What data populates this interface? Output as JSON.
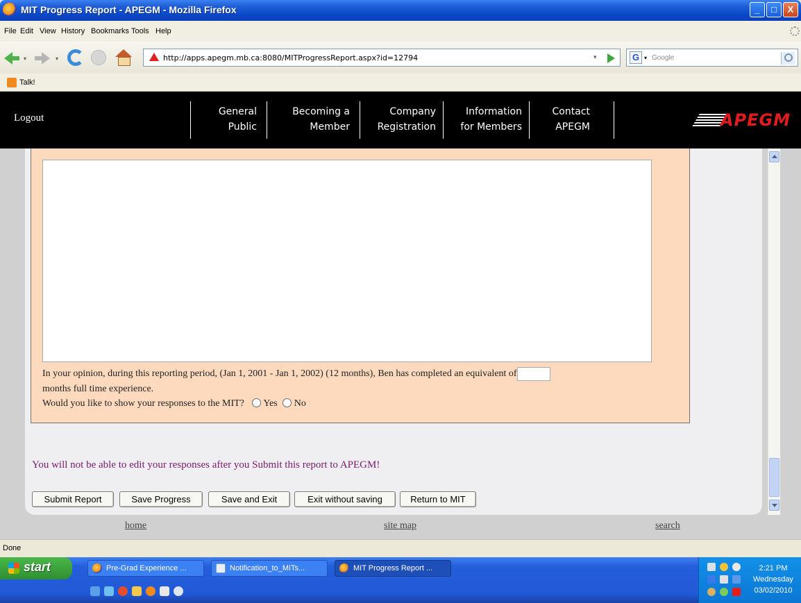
{
  "window": {
    "title": "MIT Progress Report - APEGM - Mozilla Firefox",
    "min_glyph": "_",
    "max_glyph": "□",
    "close_glyph": "X"
  },
  "menu": [
    "File",
    "Edit",
    "View",
    "History",
    "Bookmarks",
    "Tools",
    "Help"
  ],
  "toolbar": {
    "url": "http://apps.apegm.mb.ca:8080/MITProgressReport.aspx?id=12794",
    "search_placeholder": "Google",
    "search_engine_glyph": "G",
    "dropdown_glyph": "▾"
  },
  "bookmarks": {
    "item": "Talk!"
  },
  "site_nav": {
    "logout": "Logout",
    "items": [
      "General\nPublic",
      "Becoming a\nMember",
      "Company\nRegistration",
      "Information\nfor Members",
      "Contact\nAPEGM"
    ],
    "logo": "APEGM"
  },
  "form": {
    "question_text": "In your opinion, during this reporting period, (Jan 1, 2001 - Jan 1, 2002) (12 months), Ben has completed an equivalent of",
    "question_suffix": "months full time experience.",
    "months_value": "",
    "show_question": "Would you like to show your responses to the MIT?",
    "option_yes": "Yes",
    "option_no": "No",
    "warning": "You will not be able to edit your responses after you Submit this report to APEGM!",
    "buttons": [
      "Submit Report",
      "Save Progress",
      "Save and Exit",
      "Exit without saving",
      "Return to MIT"
    ]
  },
  "footer": {
    "home": "home",
    "site_map": "site map",
    "search": "search"
  },
  "status": "Done",
  "taskbar": {
    "start": "start",
    "tasks": [
      "Pre-Grad Experience ...",
      "Notification_to_MITs...",
      "MIT Progress Report ..."
    ],
    "clock_time": "2:21 PM",
    "clock_day": "Wednesday",
    "clock_date": "03/02/2010"
  },
  "colors": {
    "form_bg": "#FDD9BE",
    "warning_text": "#7A1A6E",
    "header_bg": "#000000",
    "logo_red": "#E21C1C"
  }
}
